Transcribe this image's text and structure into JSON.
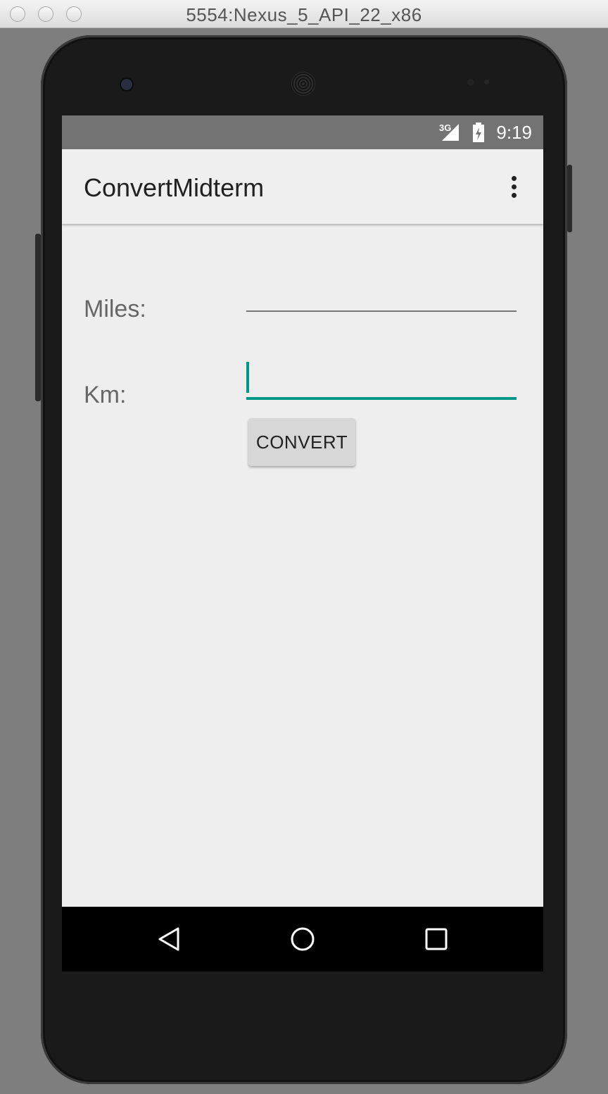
{
  "window": {
    "title": "5554:Nexus_5_API_22_x86"
  },
  "status_bar": {
    "network": "3G",
    "time": "9:19"
  },
  "app_bar": {
    "title": "ConvertMidterm",
    "menu_icon": "overflow-menu-icon"
  },
  "form": {
    "miles_label": "Miles:",
    "miles_value": "",
    "km_label": "Km:",
    "km_value": "",
    "convert_label": "CONVERT"
  },
  "nav_bar": {
    "icons": [
      "back-icon",
      "home-icon",
      "recents-icon"
    ]
  },
  "colors": {
    "accent": "#009688",
    "status_bar": "#737373",
    "app_bar": "#efefef",
    "background": "#eeeeee"
  }
}
